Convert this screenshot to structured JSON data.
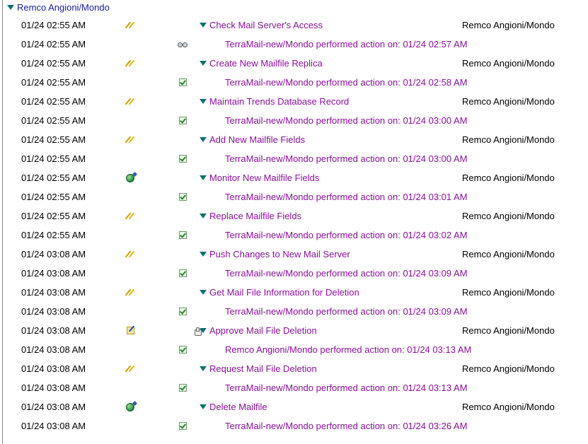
{
  "group": {
    "label": "Remco Angioni/Mondo"
  },
  "rows": [
    {
      "ts": "01/24 02:55 AM",
      "icon1": "run-icon",
      "icon2": "",
      "icon3": "",
      "title": "Check Mail Server's Access",
      "owner": "Remco Angioni/Mondo"
    },
    {
      "ts": "01/24 02:55 AM",
      "icon1": "",
      "icon2": "binoculars-icon",
      "icon3": "",
      "sub": "TerraMail-new/Mondo performed action on:  01/24 02:57 AM"
    },
    {
      "ts": "01/24 02:55 AM",
      "icon1": "run-icon",
      "icon2": "",
      "icon3": "",
      "title": "Create New Mailfile Replica",
      "owner": "Remco Angioni/Mondo"
    },
    {
      "ts": "01/24 02:55 AM",
      "icon1": "",
      "icon2": "check-icon",
      "icon3": "",
      "sub": "TerraMail-new/Mondo performed action on:  01/24 02:58 AM"
    },
    {
      "ts": "01/24 02:55 AM",
      "icon1": "run-icon",
      "icon2": "",
      "icon3": "",
      "title": "Maintain Trends Database Record",
      "owner": "Remco Angioni/Mondo"
    },
    {
      "ts": "01/24 02:55 AM",
      "icon1": "",
      "icon2": "check-icon",
      "icon3": "",
      "sub": "TerraMail-new/Mondo performed action on:  01/24 03:00 AM"
    },
    {
      "ts": "01/24 02:55 AM",
      "icon1": "run-icon",
      "icon2": "",
      "icon3": "",
      "title": "Add New Mailfile Fields",
      "owner": "Remco Angioni/Mondo"
    },
    {
      "ts": "01/24 02:55 AM",
      "icon1": "",
      "icon2": "check-icon",
      "icon3": "",
      "sub": "TerraMail-new/Mondo performed action on:  01/24 03:00 AM"
    },
    {
      "ts": "01/24 02:55 AM",
      "icon1": "globe-icon",
      "icon2": "",
      "icon3": "",
      "title": "Monitor New Mailfile Fields",
      "owner": "Remco Angioni/Mondo"
    },
    {
      "ts": "01/24 02:55 AM",
      "icon1": "",
      "icon2": "check-icon",
      "icon3": "",
      "sub": "TerraMail-new/Mondo performed action on:  01/24 03:01 AM"
    },
    {
      "ts": "01/24 02:55 AM",
      "icon1": "run-icon",
      "icon2": "",
      "icon3": "",
      "title": "Replace Mailfile Fields",
      "owner": "Remco Angioni/Mondo"
    },
    {
      "ts": "01/24 02:55 AM",
      "icon1": "",
      "icon2": "check-icon",
      "icon3": "",
      "sub": "TerraMail-new/Mondo performed action on:  01/24 03:02 AM"
    },
    {
      "ts": "01/24 03:08 AM",
      "icon1": "run-icon",
      "icon2": "",
      "icon3": "",
      "title": "Push Changes to New Mail Server",
      "owner": "Remco Angioni/Mondo"
    },
    {
      "ts": "01/24 03:08 AM",
      "icon1": "",
      "icon2": "check-icon",
      "icon3": "",
      "sub": "TerraMail-new/Mondo performed action on:  01/24 03:09 AM"
    },
    {
      "ts": "01/24 03:08 AM",
      "icon1": "run-icon",
      "icon2": "",
      "icon3": "",
      "title": "Get Mail File Information for Deletion",
      "owner": "Remco Angioni/Mondo"
    },
    {
      "ts": "01/24 03:08 AM",
      "icon1": "",
      "icon2": "check-icon",
      "icon3": "",
      "sub": "TerraMail-new/Mondo performed action on:  01/24 03:09 AM"
    },
    {
      "ts": "01/24 03:08 AM",
      "icon1": "approve-icon",
      "icon2": "",
      "icon3": "thumbs-up-icon",
      "title": "Approve Mail File Deletion",
      "owner": "Remco Angioni/Mondo"
    },
    {
      "ts": "01/24 03:08 AM",
      "icon1": "",
      "icon2": "check-icon",
      "icon3": "",
      "sub": "Remco Angioni/Mondo performed action on:  01/24 03:13 AM"
    },
    {
      "ts": "01/24 03:08 AM",
      "icon1": "run-icon",
      "icon2": "",
      "icon3": "",
      "title": "Request Mail File Deletion",
      "owner": "Remco Angioni/Mondo"
    },
    {
      "ts": "01/24 03:08 AM",
      "icon1": "",
      "icon2": "check-icon",
      "icon3": "",
      "sub": "TerraMail-new/Mondo performed action on:  01/24 03:13 AM"
    },
    {
      "ts": "01/24 03:08 AM",
      "icon1": "globe-icon",
      "icon2": "",
      "icon3": "",
      "title": "Delete Mailfile",
      "owner": "Remco Angioni/Mondo"
    },
    {
      "ts": "01/24 03:08 AM",
      "icon1": "",
      "icon2": "check-icon",
      "icon3": "",
      "sub": "TerraMail-new/Mondo performed action on:  01/24 03:26 AM"
    }
  ]
}
